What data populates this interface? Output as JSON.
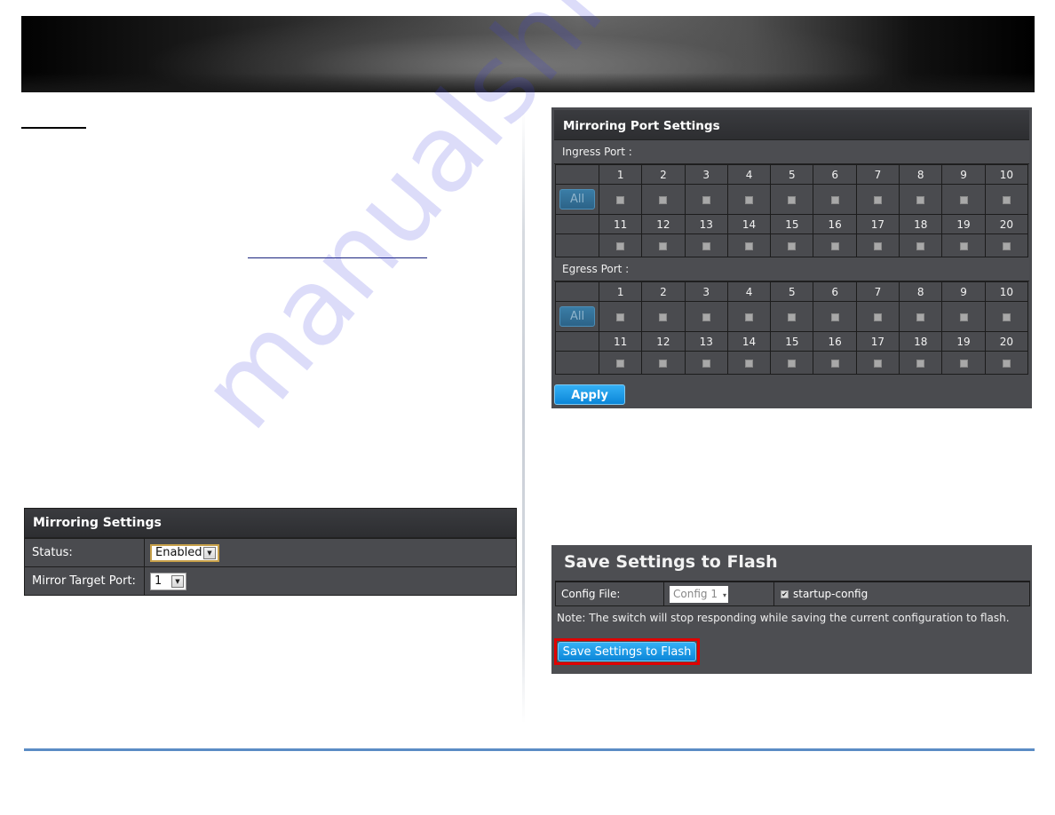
{
  "mirroring_settings": {
    "title": "Mirroring Settings",
    "status_label": "Status:",
    "status_value": "Enabled",
    "target_port_label": "Mirror Target Port:",
    "target_port_value": "1"
  },
  "mirroring_port_settings": {
    "title": "Mirroring Port Settings",
    "ingress_label": "Ingress Port :",
    "egress_label": "Egress Port :",
    "all_label": "All",
    "apply_label": "Apply",
    "ports_row1": [
      "1",
      "2",
      "3",
      "4",
      "5",
      "6",
      "7",
      "8",
      "9",
      "10"
    ],
    "ports_row2": [
      "11",
      "12",
      "13",
      "14",
      "15",
      "16",
      "17",
      "18",
      "19",
      "20"
    ],
    "ingress_checked": [
      false,
      false,
      false,
      false,
      false,
      false,
      false,
      false,
      false,
      false,
      false,
      false,
      false,
      false,
      false,
      false,
      false,
      false,
      false,
      false
    ],
    "egress_checked": [
      false,
      false,
      false,
      false,
      false,
      false,
      false,
      false,
      false,
      false,
      false,
      false,
      false,
      false,
      false,
      false,
      false,
      false,
      false,
      false
    ]
  },
  "save_settings": {
    "title": "Save Settings to Flash",
    "config_file_label": "Config File:",
    "config_file_value": "Config 1",
    "startup_config_label": "startup-config",
    "startup_config_checked": true,
    "note": "Note: The switch will stop responding while saving the current configuration to flash.",
    "button_label": "Save Settings to Flash"
  },
  "icons": {
    "dropdown": "▾",
    "checkbox_checked": "✔"
  },
  "colors": {
    "panel_bg": "#4a4b4f",
    "button_blue": "#1a9be6",
    "highlight_red": "#e10000",
    "footer_rule": "#5b8cc5"
  },
  "watermark": "manualshive.com"
}
